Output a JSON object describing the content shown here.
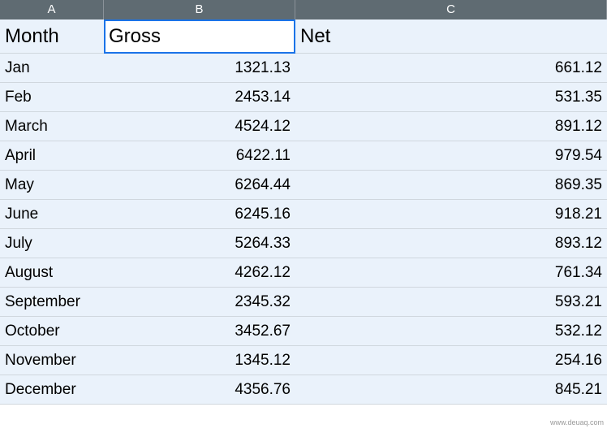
{
  "columns": [
    "A",
    "B",
    "C"
  ],
  "headers": {
    "month": "Month",
    "gross": "Gross",
    "net": "Net"
  },
  "rows": [
    {
      "month": "Jan",
      "gross": "1321.13",
      "net": "661.12"
    },
    {
      "month": "Feb",
      "gross": "2453.14",
      "net": "531.35"
    },
    {
      "month": "March",
      "gross": "4524.12",
      "net": "891.12"
    },
    {
      "month": "April",
      "gross": "6422.11",
      "net": "979.54"
    },
    {
      "month": "May",
      "gross": "6264.44",
      "net": "869.35"
    },
    {
      "month": "June",
      "gross": "6245.16",
      "net": "918.21"
    },
    {
      "month": "July",
      "gross": "5264.33",
      "net": "893.12"
    },
    {
      "month": "August",
      "gross": "4262.12",
      "net": "761.34"
    },
    {
      "month": "September",
      "gross": "2345.32",
      "net": "593.21"
    },
    {
      "month": "October",
      "gross": "3452.67",
      "net": "532.12"
    },
    {
      "month": "November",
      "gross": "1345.12",
      "net": "254.16"
    },
    {
      "month": "December",
      "gross": "4356.76",
      "net": "845.21"
    }
  ],
  "watermark": "www.deuaq.com",
  "chart_data": {
    "type": "table",
    "title": "",
    "columns": [
      "Month",
      "Gross",
      "Net"
    ],
    "categories": [
      "Jan",
      "Feb",
      "March",
      "April",
      "May",
      "June",
      "July",
      "August",
      "September",
      "October",
      "November",
      "December"
    ],
    "series": [
      {
        "name": "Gross",
        "values": [
          1321.13,
          2453.14,
          4524.12,
          6422.11,
          6264.44,
          6245.16,
          5264.33,
          4262.12,
          2345.32,
          3452.67,
          1345.12,
          4356.76
        ]
      },
      {
        "name": "Net",
        "values": [
          661.12,
          531.35,
          891.12,
          979.54,
          869.35,
          918.21,
          893.12,
          761.34,
          593.21,
          532.12,
          254.16,
          845.21
        ]
      }
    ]
  }
}
